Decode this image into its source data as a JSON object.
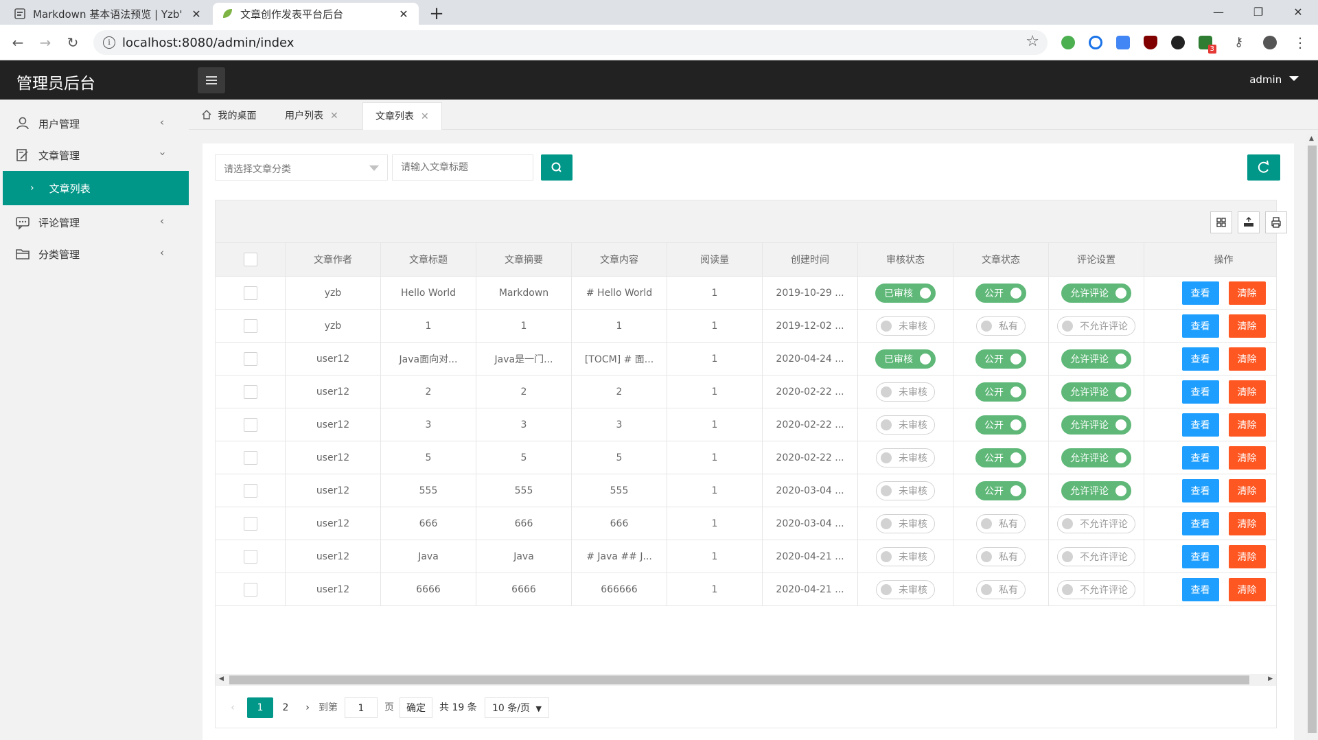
{
  "browser": {
    "tabs": [
      {
        "title": "Markdown 基本语法预览 | Yzb'",
        "active": false
      },
      {
        "title": "文章创作发表平台后台",
        "active": true
      }
    ],
    "url": "localhost:8080/admin/index",
    "extension_badge": "3"
  },
  "app": {
    "logo": "管理员后台",
    "user": "admin"
  },
  "sidebar": {
    "items": [
      {
        "label": "用户管理",
        "icon": "user-icon"
      },
      {
        "label": "文章管理",
        "icon": "edit-icon"
      },
      {
        "label": "文章列表",
        "icon": "chevron-right-icon"
      },
      {
        "label": "评论管理",
        "icon": "comment-icon"
      },
      {
        "label": "分类管理",
        "icon": "folder-icon"
      }
    ]
  },
  "page_tabs": [
    {
      "label": "我的桌面"
    },
    {
      "label": "用户列表"
    },
    {
      "label": "文章列表"
    }
  ],
  "search": {
    "category_placeholder": "请选择文章分类",
    "title_placeholder": "请输入文章标题"
  },
  "table": {
    "headers": [
      "文章作者",
      "文章标题",
      "文章摘要",
      "文章内容",
      "阅读量",
      "创建时间",
      "审核状态",
      "文章状态",
      "评论设置",
      "操作"
    ],
    "rows": [
      {
        "author": "yzb",
        "title": "Hello World",
        "summary": "Markdown",
        "content": "# Hello World",
        "reads": "1",
        "created": "2019-10-29 ...",
        "audit": "已审核",
        "audit_on": true,
        "status": "公开",
        "status_on": true,
        "comment": "允许评论",
        "comment_on": true
      },
      {
        "author": "yzb",
        "title": "1",
        "summary": "1",
        "content": "1",
        "reads": "1",
        "created": "2019-12-02 ...",
        "audit": "未审核",
        "audit_on": false,
        "status": "私有",
        "status_on": false,
        "comment": "不允许评论",
        "comment_on": false
      },
      {
        "author": "user12",
        "title": "Java面向对...",
        "summary": "Java是一门...",
        "content": "[TOCM] # 面...",
        "reads": "1",
        "created": "2020-04-24 ...",
        "audit": "已审核",
        "audit_on": true,
        "status": "公开",
        "status_on": true,
        "comment": "允许评论",
        "comment_on": true
      },
      {
        "author": "user12",
        "title": "2",
        "summary": "2",
        "content": "2",
        "reads": "1",
        "created": "2020-02-22 ...",
        "audit": "未审核",
        "audit_on": false,
        "status": "公开",
        "status_on": true,
        "comment": "允许评论",
        "comment_on": true
      },
      {
        "author": "user12",
        "title": "3",
        "summary": "3",
        "content": "3",
        "reads": "1",
        "created": "2020-02-22 ...",
        "audit": "未审核",
        "audit_on": false,
        "status": "公开",
        "status_on": true,
        "comment": "允许评论",
        "comment_on": true
      },
      {
        "author": "user12",
        "title": "5",
        "summary": "5",
        "content": "5",
        "reads": "1",
        "created": "2020-02-22 ...",
        "audit": "未审核",
        "audit_on": false,
        "status": "公开",
        "status_on": true,
        "comment": "允许评论",
        "comment_on": true
      },
      {
        "author": "user12",
        "title": "555",
        "summary": "555",
        "content": "555",
        "reads": "1",
        "created": "2020-03-04 ...",
        "audit": "未审核",
        "audit_on": false,
        "status": "公开",
        "status_on": true,
        "comment": "允许评论",
        "comment_on": true
      },
      {
        "author": "user12",
        "title": "666",
        "summary": "666",
        "content": "666",
        "reads": "1",
        "created": "2020-03-04 ...",
        "audit": "未审核",
        "audit_on": false,
        "status": "私有",
        "status_on": false,
        "comment": "不允许评论",
        "comment_on": false
      },
      {
        "author": "user12",
        "title": "Java",
        "summary": "Java",
        "content": "# Java ## J...",
        "reads": "1",
        "created": "2020-04-21 ...",
        "audit": "未审核",
        "audit_on": false,
        "status": "私有",
        "status_on": false,
        "comment": "不允许评论",
        "comment_on": false
      },
      {
        "author": "user12",
        "title": "6666",
        "summary": "6666",
        "content": "666666",
        "reads": "1",
        "created": "2020-04-21 ...",
        "audit": "未审核",
        "audit_on": false,
        "status": "私有",
        "status_on": false,
        "comment": "不允许评论",
        "comment_on": false
      }
    ],
    "view_label": "查看",
    "delete_label": "清除"
  },
  "pager": {
    "pages": [
      "1",
      "2"
    ],
    "current": "1",
    "goto_label": "到第",
    "goto_value": "1",
    "page_unit": "页",
    "confirm_label": "确定",
    "total": "共 19 条",
    "page_size": "10 条/页"
  },
  "colors": {
    "primary": "#009688",
    "switch_on": "#5fb878",
    "view": "#1e9fff",
    "delete": "#ff5722",
    "header_bg": "#222222"
  }
}
